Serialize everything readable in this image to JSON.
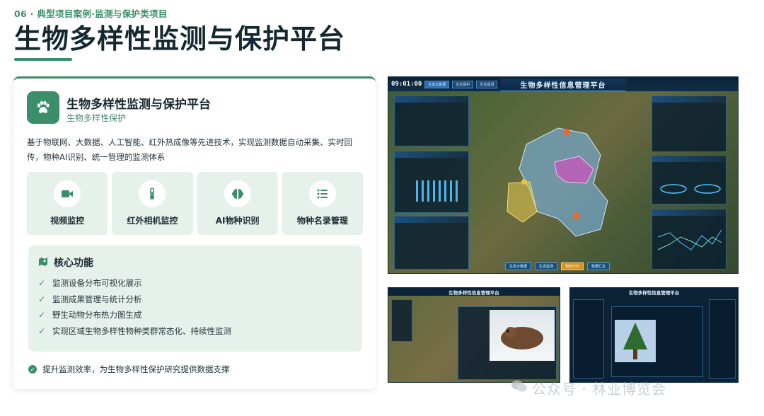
{
  "header": {
    "section_label": "06 · 典型项目案例·监测与保护类项目",
    "title": "生物多样性监测与保护平台"
  },
  "card": {
    "title": "生物多样性监测与保护平台",
    "subtitle": "生物多样性保护",
    "description": "基于物联网、大数据、人工智能、红外热成像等先进技术，实现监测数据自动采集、实时回传，物种AI识别、统一管理的监测体系",
    "features": [
      {
        "label": "视频监控",
        "icon": "video-camera-icon"
      },
      {
        "label": "红外相机监控",
        "icon": "thermometer-icon"
      },
      {
        "label": "AI物种识别",
        "icon": "brain-icon"
      },
      {
        "label": "物种名录管理",
        "icon": "list-icon"
      }
    ],
    "core": {
      "title": "核心功能",
      "items": [
        "监测设备分布可视化展示",
        "监测成果管理与统计分析",
        "野生动物分布热力图生成",
        "实现区域生物多样性物种类群常态化、持续性监测"
      ]
    },
    "footer_note": "提升监测效率，为生物多样性保护研究提供数据支撑"
  },
  "dashboard": {
    "clock": "09:01:00",
    "tabs": [
      "生态大数据",
      "生态保护",
      "生态监测"
    ],
    "title": "生物多样性信息管理平台",
    "bottom_buttons": [
      "生态大数据",
      "生态监测",
      "物种分布",
      "数据汇总"
    ],
    "sub_title": "生物多样性信息管理平台"
  },
  "watermark": "公众号 · 林业博览会",
  "colors": {
    "accent": "#3a8f6a",
    "tile_bg": "#e7f1ec",
    "dash_bg": "#0b2237"
  }
}
